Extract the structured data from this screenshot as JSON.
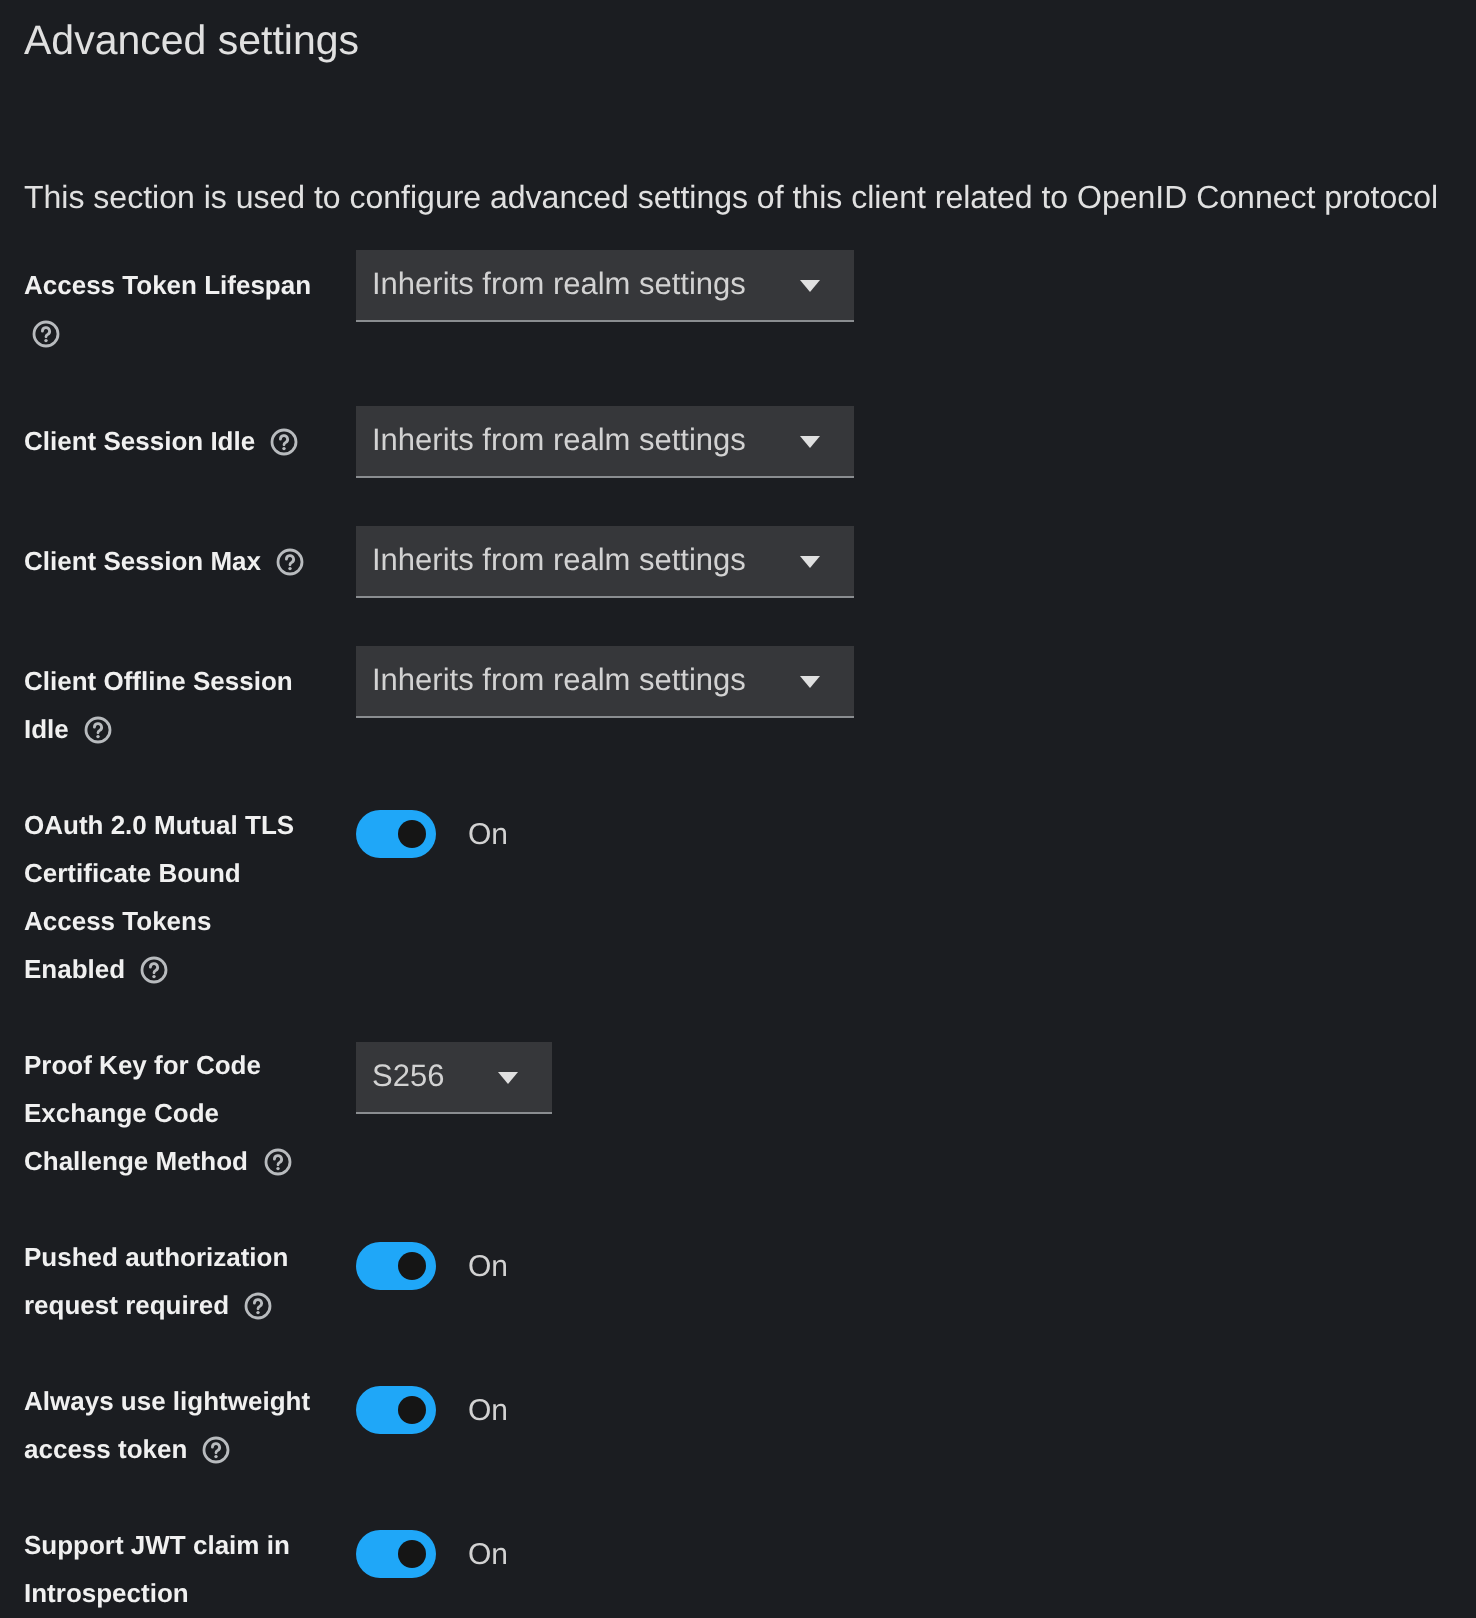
{
  "title": "Advanced settings",
  "description": "This section is used to configure advanced settings of this client related to OpenID Connect protocol",
  "fields": [
    {
      "kind": "select",
      "label": [
        "Access Token Lifespan"
      ],
      "help": true,
      "value": "Inherits from realm settings"
    },
    {
      "kind": "select",
      "label": [
        "Client Session Idle"
      ],
      "help": true,
      "value": "Inherits from realm settings"
    },
    {
      "kind": "select",
      "label": [
        "Client Session Max"
      ],
      "help": true,
      "value": "Inherits from realm settings"
    },
    {
      "kind": "select",
      "label": [
        "Client Offline Session",
        "Idle"
      ],
      "help": true,
      "value": "Inherits from realm settings"
    },
    {
      "kind": "toggle",
      "label": [
        "OAuth 2.0 Mutual TLS",
        "Certificate Bound",
        "Access Tokens",
        "Enabled"
      ],
      "help": true,
      "on": true,
      "state_text": "On"
    },
    {
      "kind": "select",
      "label": [
        "Proof Key for Code",
        "Exchange Code",
        "Challenge Method"
      ],
      "help": true,
      "value": "S256"
    },
    {
      "kind": "toggle",
      "label": [
        "Pushed authorization",
        "request required"
      ],
      "help": true,
      "on": true,
      "state_text": "On"
    },
    {
      "kind": "toggle",
      "label": [
        "Always use lightweight",
        "access token"
      ],
      "help": true,
      "on": true,
      "state_text": "On"
    },
    {
      "kind": "toggle",
      "label": [
        "Support JWT claim in",
        "Introspection"
      ],
      "help": false,
      "on": true,
      "state_text": "On"
    }
  ]
}
